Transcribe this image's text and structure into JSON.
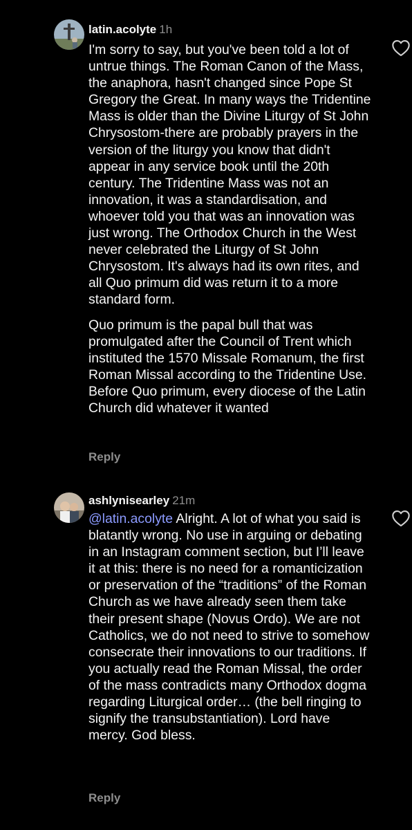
{
  "comments": [
    {
      "username": "latin.acolyte",
      "time": "1h",
      "paragraphs": [
        "I'm sorry to say, but you've been told a lot of untrue things. The Roman Canon of the Mass, the anaphora, hasn't changed since Pope St Gregory the Great. In many ways the Tridentine Mass is older than the Divine Liturgy of St John Chrysostom-there are probably prayers in the version of the liturgy you know that didn't appear in any service book until the 20th century. The Tridentine Mass was not an innovation, it was a standardisation, and whoever told you that was an innovation was just wrong. The Orthodox Church in the West never celebrated the Liturgy of St John Chrysostom. It's always had its own rites, and all Quo primum did was return it to a more standard form.",
        "Quo primum is the papal bull that was promulgated after the Council of Trent which instituted the 1570 Missale Romanum, the first Roman Missal according to the Tridentine Use. Before Quo primum, every diocese of the Latin Church did whatever it wanted"
      ],
      "reply_label": "Reply",
      "avatar_icon": "avatar-cross-photo",
      "like_icon": "heart-outline-icon"
    },
    {
      "username": "ashlynisearley",
      "time": "21m",
      "mention": "@latin.acolyte",
      "text": " Alright. A lot of what you said is blatantly wrong. No use in arguing or debating in an Instagram comment section, but I’ll leave it at this: there is no need for a romanticization or preservation of the “traditions” of the Roman Church as we have already seen them take their present shape (Novus Ordo). We are not Catholics, we do not need to strive to somehow consecrate their innovations to our traditions. If you actually read the Roman Missal, the order of the mass contradicts many Orthodox dogma regarding Liturgical order… (the bell ringing to signify the transubstantiation). Lord have mercy. God bless.",
      "reply_label": "Reply",
      "avatar_icon": "avatar-people-photo",
      "like_icon": "heart-outline-icon"
    }
  ],
  "colors": {
    "background": "#000000",
    "text": "#f5f5f5",
    "secondary": "#8e8e8e",
    "mention": "#8c9bff"
  }
}
